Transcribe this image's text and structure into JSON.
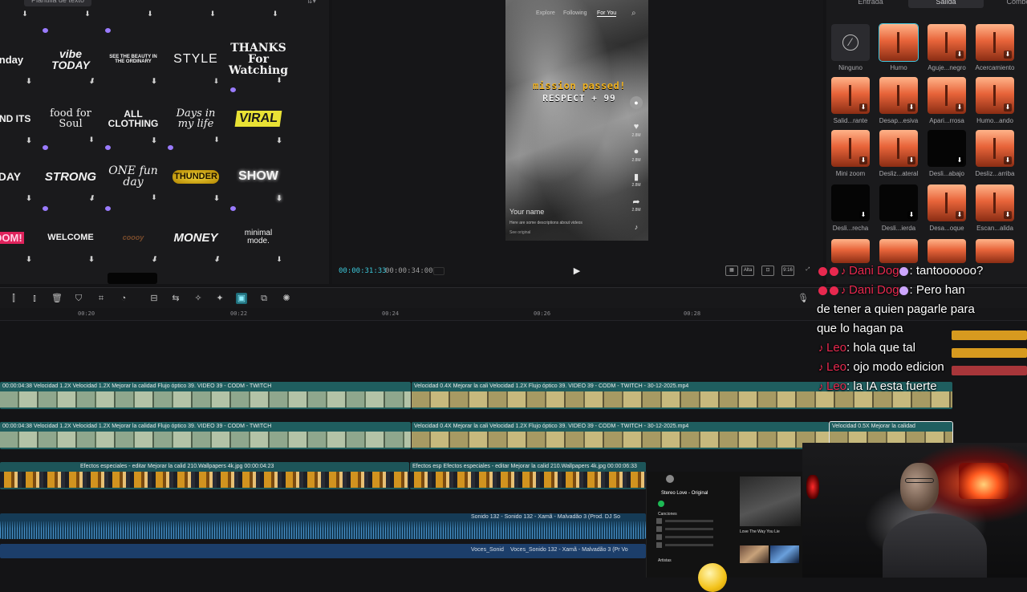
{
  "text_templates": {
    "tab_label": "Plantilla de texto",
    "items": [
      {
        "text": "onday"
      },
      {
        "text": "vibe TODAY"
      },
      {
        "text": "SEE THE BEAUTY IN THE ORDINARY"
      },
      {
        "text": "STYLE"
      },
      {
        "text": "THANKS For Watching"
      },
      {
        "text": "YOND ITS"
      },
      {
        "text": "food for Soul"
      },
      {
        "text": "ALL CLOTHING"
      },
      {
        "text": "Days in my life"
      },
      {
        "text": "VIRAL"
      },
      {
        "text": "IDAY"
      },
      {
        "text": "STRONG"
      },
      {
        "text": "ONE fun day"
      },
      {
        "text": "THUNDER"
      },
      {
        "text": "SHOW"
      },
      {
        "text": "OOM!"
      },
      {
        "text": "WELCOME"
      },
      {
        "text": "coooy"
      },
      {
        "text": "MONEY"
      },
      {
        "text": "minimal mode."
      }
    ]
  },
  "preview": {
    "phone": {
      "nav": [
        "Explore",
        "Following",
        "For You"
      ],
      "mission_line1": "mission passed!",
      "mission_line2": "RESPECT + 99",
      "counts": [
        "2.8M",
        "2.8M",
        "2.8M",
        "2.8M"
      ],
      "username": "Your name",
      "description": "Here are some descriptions about videos",
      "see_more": "See original"
    },
    "timecode_current": "00:00:31:33",
    "timecode_total": "00:00:34:00",
    "tools": [
      "Altа",
      "9:16"
    ]
  },
  "transitions": {
    "tabs": [
      "Entrada",
      "Salida",
      "Combo"
    ],
    "active_tab": "Salida",
    "items": [
      {
        "label": "Ninguno",
        "style": "none"
      },
      {
        "label": "Humo",
        "style": "sel"
      },
      {
        "label": "Aguje...negro",
        "style": "normal"
      },
      {
        "label": "Acercamiento",
        "style": "normal"
      },
      {
        "label": "Salid...rante",
        "style": "normal"
      },
      {
        "label": "Desap...esiva",
        "style": "normal"
      },
      {
        "label": "Apari...rrosa",
        "style": "normal"
      },
      {
        "label": "Humo...ando",
        "style": "normal"
      },
      {
        "label": "Mini zoom",
        "style": "normal"
      },
      {
        "label": "Desliz...ateral",
        "style": "normal"
      },
      {
        "label": "Desli...abajo",
        "style": "dark"
      },
      {
        "label": "Desliz...arriba",
        "style": "normal"
      },
      {
        "label": "Desli...recha",
        "style": "dark"
      },
      {
        "label": "Desli...ierda",
        "style": "dark"
      },
      {
        "label": "Desa...oque",
        "style": "normal"
      },
      {
        "label": "Escan...alida",
        "style": "normal"
      }
    ]
  },
  "timeline": {
    "ruler": [
      "00:20",
      "00:22",
      "00:24",
      "00:26",
      "00:28"
    ],
    "track1": [
      {
        "label": "00:00:04:38  Velocidad 1.2X  Velocidad 1.2X  Mejorar la calidad  Flujo óptico  39. VIDEO 39 - CODM - TWITCH"
      },
      {
        "label": "Velocidad 0.4X  Mejorar la cali  Velocidad 1.2X  Flujo óptico  39. VIDEO 39 - CODM - TWITCH - 30-12-2025.mp4"
      }
    ],
    "track2": [
      {
        "label": "00:00:04:38  Velocidad 1.2X  Velocidad 1.2X  Mejorar la calidad  Flujo óptico  39. VIDEO 39 - CODM - TWITCH"
      },
      {
        "label": "Velocidad 0.4X  Mejorar la cali  Velocidad 1.2X  Flujo óptico  39. VIDEO 39 - CODM - TWITCH - 30-12-2025.mp4"
      },
      {
        "label": "Velocidad 0.5X  Mejorar la calidad"
      }
    ],
    "fx_track": [
      {
        "label": "Efectos especiales - editar  Mejorar la calid  210.Wallpapers 4k.jpg  00:00:04:23"
      },
      {
        "label": "Efectos esp  Efectos especiales - editar  Mejorar la calid  210.Wallpapers 4k.jpg  00:00:06:33"
      }
    ],
    "audio1_label": "Sonido 132 - Sonido 132 - Xamã - Malvadão 3 (Prod. DJ So",
    "audio2_label_a": "Voces_Sonid",
    "audio2_label_b": "Voces_Sonido 132 - Xamã - Malvadão 3 (Pr Vo"
  },
  "chat": [
    {
      "user": "Dani Dog",
      "message": ": tantoooooo?"
    },
    {
      "user": "Dani Dog",
      "message": ": Pero han"
    },
    {
      "user": "",
      "message": "de tener a quien pagarle para"
    },
    {
      "user": "",
      "message": "que lo hagan pa"
    },
    {
      "user": "Leo",
      "message": ": hola que tal"
    },
    {
      "user": "Leo",
      "message": ": ojo modo edicion"
    },
    {
      "user": "Leo",
      "message": ": la IA esta fuerte"
    }
  ],
  "spotify": {
    "title": "Stereo Love - Original",
    "section": "Canciones",
    "section2": "Artistas",
    "featured": "Love The Way You Lie"
  },
  "colors": {
    "accent": "#3cc7d9",
    "chat_user": "#e8294f",
    "clip_teal": "#1f5e5f",
    "audio_blue": "#153b56"
  }
}
